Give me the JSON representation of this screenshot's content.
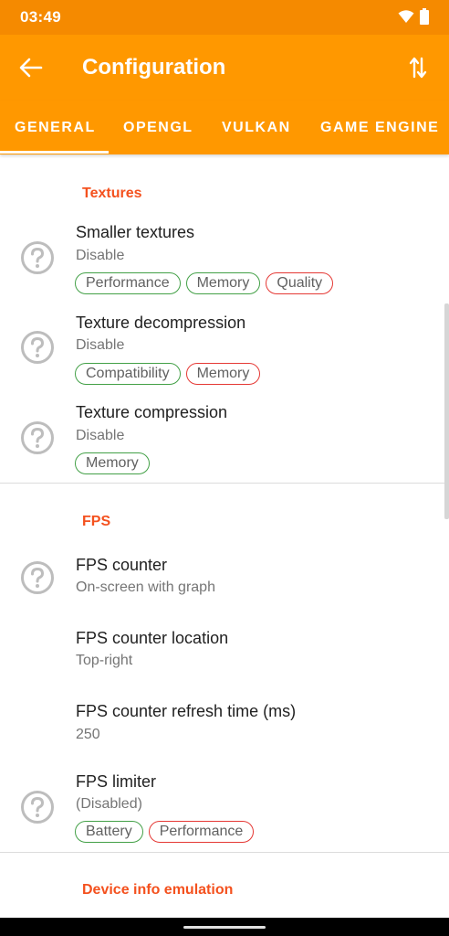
{
  "status_bar": {
    "time": "03:49"
  },
  "app_bar": {
    "title": "Configuration"
  },
  "tabs": [
    {
      "label": "GENERAL",
      "selected": true
    },
    {
      "label": "OPENGL"
    },
    {
      "label": "VULKAN"
    },
    {
      "label": "GAME ENGINE"
    }
  ],
  "colors": {
    "primary": "#ff9800",
    "status_bar": "#f58a00",
    "section_header": "#f4511e",
    "chip_positive": "#43a047",
    "chip_negative": "#e53935"
  },
  "sections": [
    {
      "header": "Textures",
      "settings": [
        {
          "title": "Smaller textures",
          "value": "Disable",
          "icon": "help-circle-icon",
          "tags": [
            {
              "label": "Performance",
              "type": "positive"
            },
            {
              "label": "Memory",
              "type": "positive"
            },
            {
              "label": "Quality",
              "type": "negative"
            }
          ]
        },
        {
          "title": "Texture decompression",
          "value": "Disable",
          "icon": "help-circle-icon",
          "tags": [
            {
              "label": "Compatibility",
              "type": "positive"
            },
            {
              "label": "Memory",
              "type": "negative"
            }
          ]
        },
        {
          "title": "Texture compression",
          "value": "Disable",
          "icon": "help-circle-icon",
          "tags": [
            {
              "label": "Memory",
              "type": "positive"
            }
          ]
        }
      ]
    },
    {
      "header": "FPS",
      "settings": [
        {
          "title": "FPS counter",
          "value": "On-screen with graph",
          "icon": "help-circle-icon"
        },
        {
          "title": "FPS counter location",
          "value": "Top-right"
        },
        {
          "title": "FPS counter refresh time (ms)",
          "value": "250"
        },
        {
          "title": "FPS limiter",
          "value": "(Disabled)",
          "icon": "help-circle-icon",
          "tags": [
            {
              "label": "Battery",
              "type": "positive"
            },
            {
              "label": "Performance",
              "type": "negative"
            }
          ]
        }
      ]
    },
    {
      "header": "Device info emulation"
    }
  ]
}
